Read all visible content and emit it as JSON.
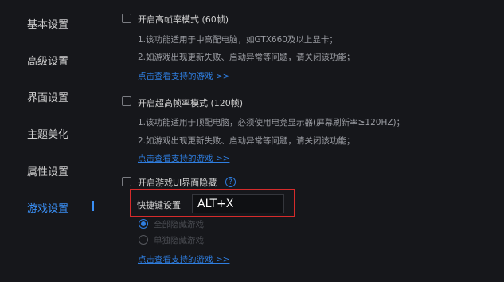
{
  "sidebar": {
    "items": [
      {
        "label": "基本设置"
      },
      {
        "label": "高级设置"
      },
      {
        "label": "界面设置"
      },
      {
        "label": "主题美化"
      },
      {
        "label": "属性设置"
      },
      {
        "label": "游戏设置"
      }
    ],
    "active_index": 5
  },
  "options": {
    "high_fps": {
      "label": "开启高帧率模式 (60帧)",
      "desc1": "1.该功能适用于中高配电脑，如GTX660及以上显卡；",
      "desc2": "2.如游戏出现更新失败、启动异常等问题，请关闭该功能；",
      "link": "点击查看支持的游戏 >>"
    },
    "ultra_fps": {
      "label": "开启超高帧率模式 (120帧)",
      "desc1": "1.该功能适用于顶配电脑，必须使用电竞显示器(屏幕刷新率≥120HZ)；",
      "desc2": "2.如游戏出现更新失败、启动异常等问题，请关闭该功能；",
      "link": "点击查看支持的游戏 >>"
    },
    "hide_ui": {
      "label": "开启游戏UI界面隐藏",
      "help_glyph": "?",
      "hotkey_label": "快捷键设置",
      "hotkey_value": "ALT+X",
      "radio1": "全部隐藏游戏",
      "radio2": "单独隐藏游戏",
      "link": "点击查看支持的游戏 >>"
    }
  },
  "colors": {
    "accent": "#2f7ee0",
    "highlight_box": "#d62b2b",
    "background": "#16171b"
  }
}
